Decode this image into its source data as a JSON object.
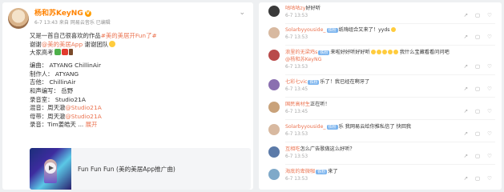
{
  "post": {
    "username": "杨和苏KeyNG",
    "meta": "6-7 13:43  来自 网易云音乐 已编辑",
    "body": {
      "l1a": "又是一首自己很喜欢的作品",
      "l1_tag": "#美的美居开Fun了#",
      "l2a": "谢谢",
      "l2_link": "@美的美居App",
      "l2b": " 谢谢团队",
      "l3": "大家高考",
      "credits": [
        "编曲：  ATYANG ChillinAir",
        "制作人：  ATYANG",
        "吉他：  ChillinAir",
        "和声编写：  岳野",
        "录音室：  Studio21A"
      ],
      "mix_label": "混音：周天澈",
      "mix_link": "@Studio21A",
      "master_label": "母带：周天澈",
      "master_link": "@Studio21A",
      "rec_label": "录音：Tim姜皓天 ... ",
      "rec_expand": "展开"
    },
    "embed": {
      "title": "Fun Fun Fun (美的美居App推广曲)"
    }
  },
  "comments": [
    {
      "name": "咕咕咕zy",
      "text": "好好听",
      "time": "6-7 13:53",
      "badge": ""
    },
    {
      "name": "Solarbyyouside_",
      "text": "纸嗨组合又来了！yyds",
      "time": "6-7 13:53",
      "badge": "铁粉"
    },
    {
      "name": "浪里的无梁鸡s",
      "text": "来啦好好听好好听",
      "text2": "我什么宝藏看看问问吧",
      "handle": "@杨和苏KeyNG",
      "time": "6-7 13:53",
      "badge": "铁粉"
    },
    {
      "name": "七彩七vic",
      "text": "乐了！我已经在啊牙了",
      "time": "6-7 13:45",
      "badge": "铁粉"
    },
    {
      "name": "国民高材生",
      "text": "正在听！",
      "time": "6-7 13:45",
      "badge": ""
    },
    {
      "name": "Solarbyyouside_",
      "text": "乐 我网易云给你推私信了 快回我",
      "time": "6-7 13:53",
      "badge": "铁粉"
    },
    {
      "name": "互相吃",
      "text": "怎么广告歌做这么好听？",
      "time": "6-7 13:53",
      "badge": ""
    },
    {
      "name": "海底的卑微咖",
      "text": "来了",
      "time": "6-7 13:53",
      "badge": "铁粉"
    }
  ],
  "actions": {
    "share": "↗",
    "comment": "▢",
    "like": "♡"
  },
  "colors": {
    "accent": "#eb7350",
    "username": "#ff8200",
    "fan_badge": "#7bb4ee"
  }
}
